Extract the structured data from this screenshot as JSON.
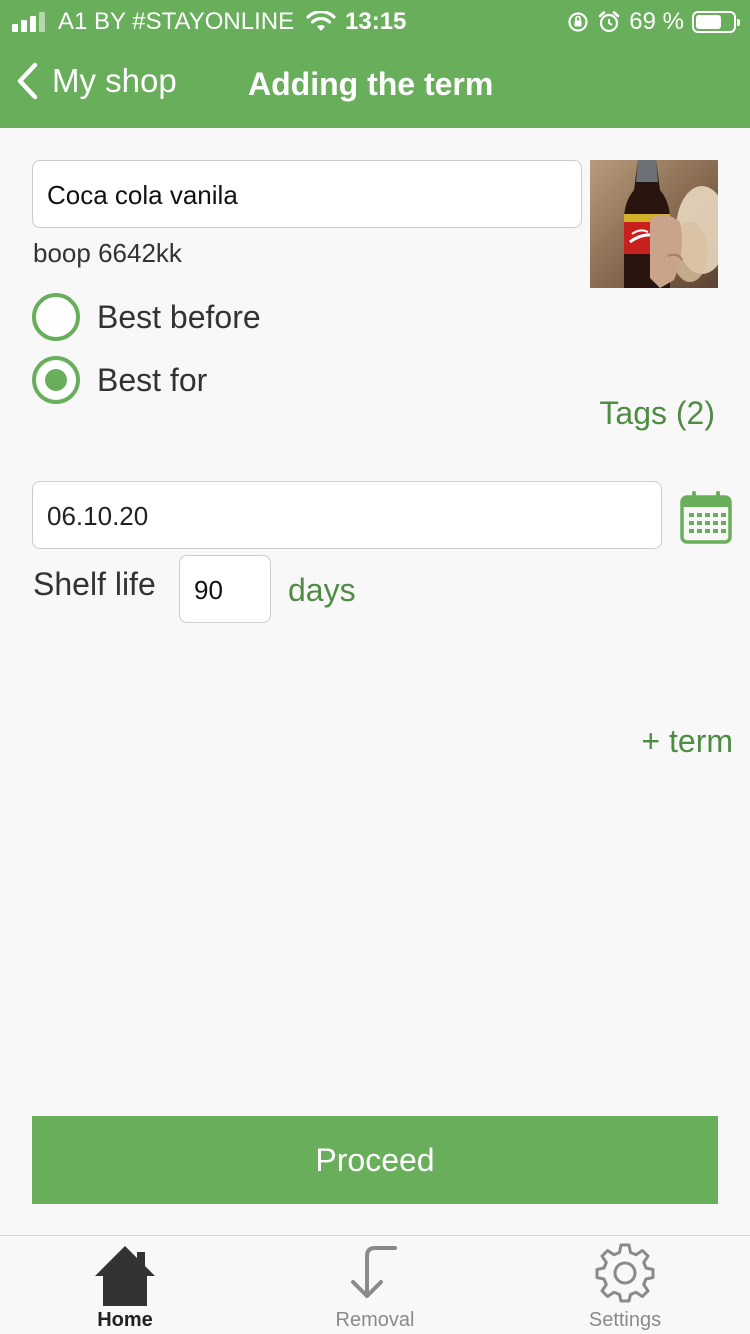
{
  "status_bar": {
    "carrier": "A1 BY #STAYONLINE",
    "time": "13:15",
    "battery_percent": "69 %",
    "battery_level": 0.69,
    "icons": [
      "signal-icon",
      "wifi-icon",
      "orientation-lock-icon",
      "alarm-icon",
      "battery-icon"
    ]
  },
  "nav": {
    "back_label": "My shop",
    "title": "Adding the term"
  },
  "product": {
    "name_value": "Coca cola vanila",
    "barcode": "boop 6642kk"
  },
  "term_type": {
    "options": [
      {
        "label": "Best before",
        "checked": false
      },
      {
        "label": "Best for",
        "checked": true
      }
    ]
  },
  "tags_label": "Tags (2)",
  "date": {
    "value": "06.10.20"
  },
  "shelf_life": {
    "label": "Shelf life",
    "value": "90",
    "unit": "days"
  },
  "add_term_label": "+ term",
  "proceed_label": "Proceed",
  "tabs": [
    {
      "label": "Home",
      "icon": "home-icon",
      "active": true
    },
    {
      "label": "Removal",
      "icon": "arrow-down-left-icon",
      "active": false
    },
    {
      "label": "Settings",
      "icon": "gear-icon",
      "active": false
    }
  ],
  "colors": {
    "accent": "#68ae5b",
    "accent_text": "#4f8c43",
    "background": "#f8f8f8"
  }
}
